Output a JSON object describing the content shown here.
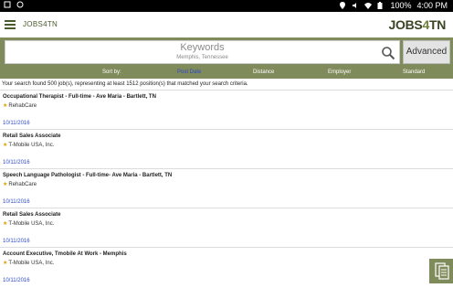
{
  "status_bar": {
    "battery": "100%",
    "time": "4:00 PM"
  },
  "app": {
    "title": "JOBS4TN",
    "logo_main": "JOBS",
    "logo_four": "4",
    "logo_tn": "TN"
  },
  "search": {
    "placeholder": "Keywords",
    "location": "Memphis, Tennessee",
    "advanced_label": "Advanced"
  },
  "sort": {
    "label": "Sort by:",
    "options": [
      "Post Date",
      "Distance",
      "Employer",
      "Standard"
    ],
    "active": "Post Date"
  },
  "summary": "Your search found 500 job(s), representing at least 1512 position(s) that matched your search criteria.",
  "jobs": [
    {
      "title": "Occupational Therapist - Full-time - Ave Maria - Bartlett, TN",
      "company": "RehabCare",
      "date": "10/11/2016"
    },
    {
      "title": "Retail Sales Associate",
      "company": "T-Mobile USA, Inc.",
      "date": "10/11/2016"
    },
    {
      "title": "Speech Language Pathologist - Full-time- Ave Maria - Bartlett, TN",
      "company": "RehabCare",
      "date": "10/11/2016"
    },
    {
      "title": "Retail Sales Associate",
      "company": "T-Mobile USA, Inc.",
      "date": "10/11/2016"
    },
    {
      "title": "Account Executive, Tmobile At Work - Memphis",
      "company": "T-Mobile USA, Inc.",
      "date": "10/11/2016"
    }
  ],
  "colors": {
    "accent": "#7f8b5a",
    "link": "#2f49c4",
    "star": "#e0a000"
  }
}
